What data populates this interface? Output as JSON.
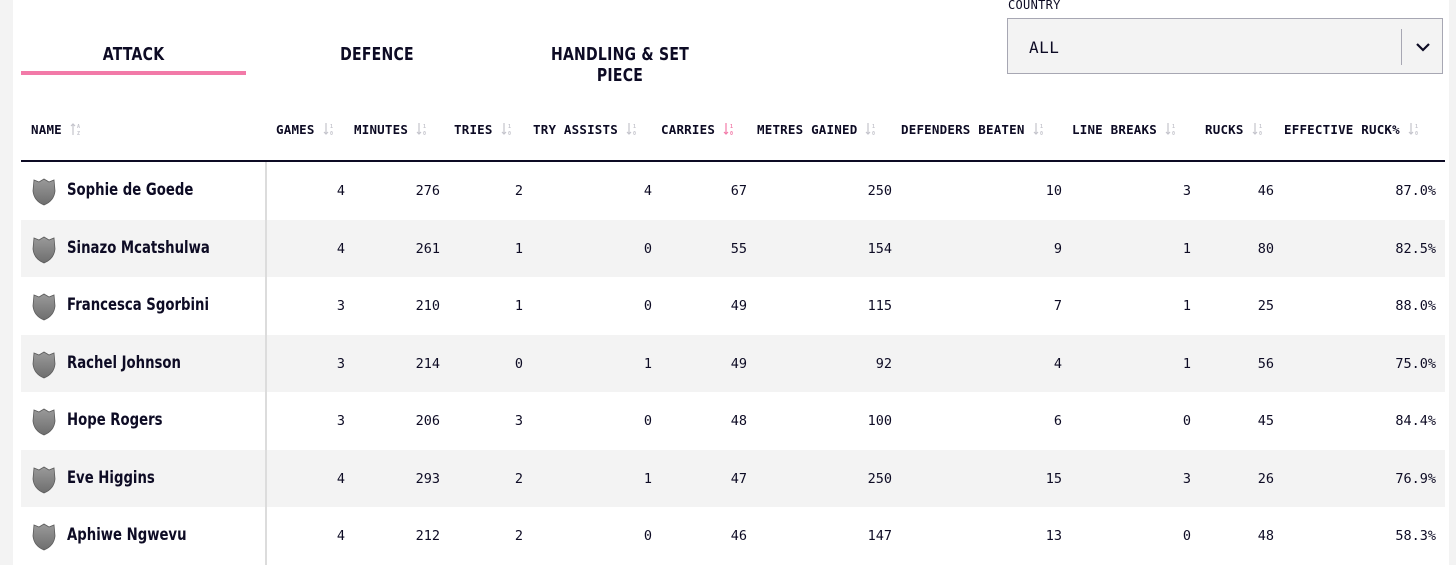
{
  "tabs": [
    {
      "label": "ATTACK",
      "active": true
    },
    {
      "label": "DEFENCE",
      "active": false
    },
    {
      "label": "HANDLING & SET PIECE",
      "active": false
    }
  ],
  "accent_color": "#f27aa8",
  "country": {
    "label": "COUNTRY",
    "value": "ALL"
  },
  "table": {
    "headers": {
      "name": "NAME",
      "games": "GAMES",
      "minutes": "MINUTES",
      "tries": "TRIES",
      "try_assists": "TRY ASSISTS",
      "carries": "CARRIES",
      "metres_gained": "METRES GAINED",
      "defenders_beaten": "DEFENDERS BEATEN",
      "line_breaks": "LINE BREAKS",
      "rucks": "RUCKS",
      "effective_ruck": "EFFECTIVE RUCK%"
    },
    "sorted_by": "carries",
    "rows": [
      {
        "name": "Sophie de Goede",
        "games": "4",
        "minutes": "276",
        "tries": "2",
        "try_assists": "4",
        "carries": "67",
        "metres_gained": "250",
        "defenders_beaten": "10",
        "line_breaks": "3",
        "rucks": "46",
        "effective_ruck": "87.0%"
      },
      {
        "name": "Sinazo Mcatshulwa",
        "games": "4",
        "minutes": "261",
        "tries": "1",
        "try_assists": "0",
        "carries": "55",
        "metres_gained": "154",
        "defenders_beaten": "9",
        "line_breaks": "1",
        "rucks": "80",
        "effective_ruck": "82.5%"
      },
      {
        "name": "Francesca Sgorbini",
        "games": "3",
        "minutes": "210",
        "tries": "1",
        "try_assists": "0",
        "carries": "49",
        "metres_gained": "115",
        "defenders_beaten": "7",
        "line_breaks": "1",
        "rucks": "25",
        "effective_ruck": "88.0%"
      },
      {
        "name": "Rachel Johnson",
        "games": "3",
        "minutes": "214",
        "tries": "0",
        "try_assists": "1",
        "carries": "49",
        "metres_gained": "92",
        "defenders_beaten": "4",
        "line_breaks": "1",
        "rucks": "56",
        "effective_ruck": "75.0%"
      },
      {
        "name": "Hope Rogers",
        "games": "3",
        "minutes": "206",
        "tries": "3",
        "try_assists": "0",
        "carries": "48",
        "metres_gained": "100",
        "defenders_beaten": "6",
        "line_breaks": "0",
        "rucks": "45",
        "effective_ruck": "84.4%"
      },
      {
        "name": "Eve Higgins",
        "games": "4",
        "minutes": "293",
        "tries": "2",
        "try_assists": "1",
        "carries": "47",
        "metres_gained": "250",
        "defenders_beaten": "15",
        "line_breaks": "3",
        "rucks": "26",
        "effective_ruck": "76.9%"
      },
      {
        "name": "Aphiwe Ngwevu",
        "games": "4",
        "minutes": "212",
        "tries": "2",
        "try_assists": "0",
        "carries": "46",
        "metres_gained": "147",
        "defenders_beaten": "13",
        "line_breaks": "0",
        "rucks": "48",
        "effective_ruck": "58.3%"
      }
    ]
  }
}
